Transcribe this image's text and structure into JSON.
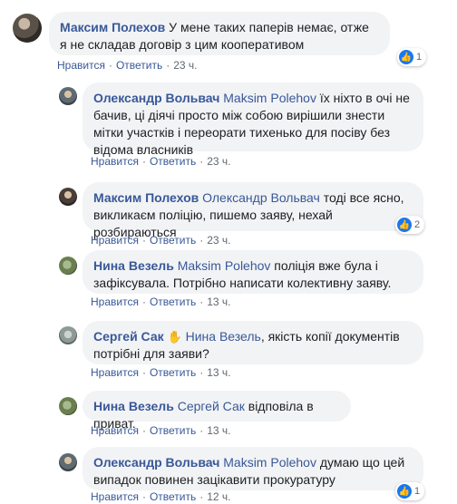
{
  "actions": {
    "like": "Нравится",
    "reply": "Ответить",
    "sep": "·"
  },
  "comments": [
    {
      "author": "Максим Полехов",
      "mention": "",
      "text": "У мене таких паперів немає, отже я не складав договір з цим кооперативом",
      "time": "23 ч.",
      "reactions": "1"
    },
    {
      "author": "Олександр Вольвач",
      "mention": "Maksim Polehov",
      "text": "їх ніхто в очі не бачив, ці діячі просто між собою вирішили знести мітки участків і переорати тихенько для посіву без відома власників",
      "time": "23 ч.",
      "reactions": ""
    },
    {
      "author": "Максим Полехов",
      "mention": "Олександр Вольвач",
      "text": "тоді все ясно, викликаєм поліцію, пишемо заяву, нехай розбираються",
      "time": "23 ч.",
      "reactions": "2"
    },
    {
      "author": "Нина Везель",
      "mention": "Maksim Polehov",
      "text": "поліція вже була і зафіксувала. Потрібно написати колективну заяву.",
      "time": "13 ч.",
      "reactions": ""
    },
    {
      "author": "Сергей Сак",
      "mention": "Нина Везель",
      "text": ", якість копії документів потрібні для заяви?",
      "time": "13 ч.",
      "reactions": ""
    },
    {
      "author": "Нина Везель",
      "mention": "Сергей Сак",
      "text": "відповіла в приват.",
      "time": "13 ч.",
      "reactions": ""
    },
    {
      "author": "Олександр Вольвач",
      "mention": "Maksim Polehov",
      "text": "думаю що цей випадок повинен зацікавити прокуратуру",
      "time": "12 ч.",
      "reactions": "1"
    }
  ]
}
